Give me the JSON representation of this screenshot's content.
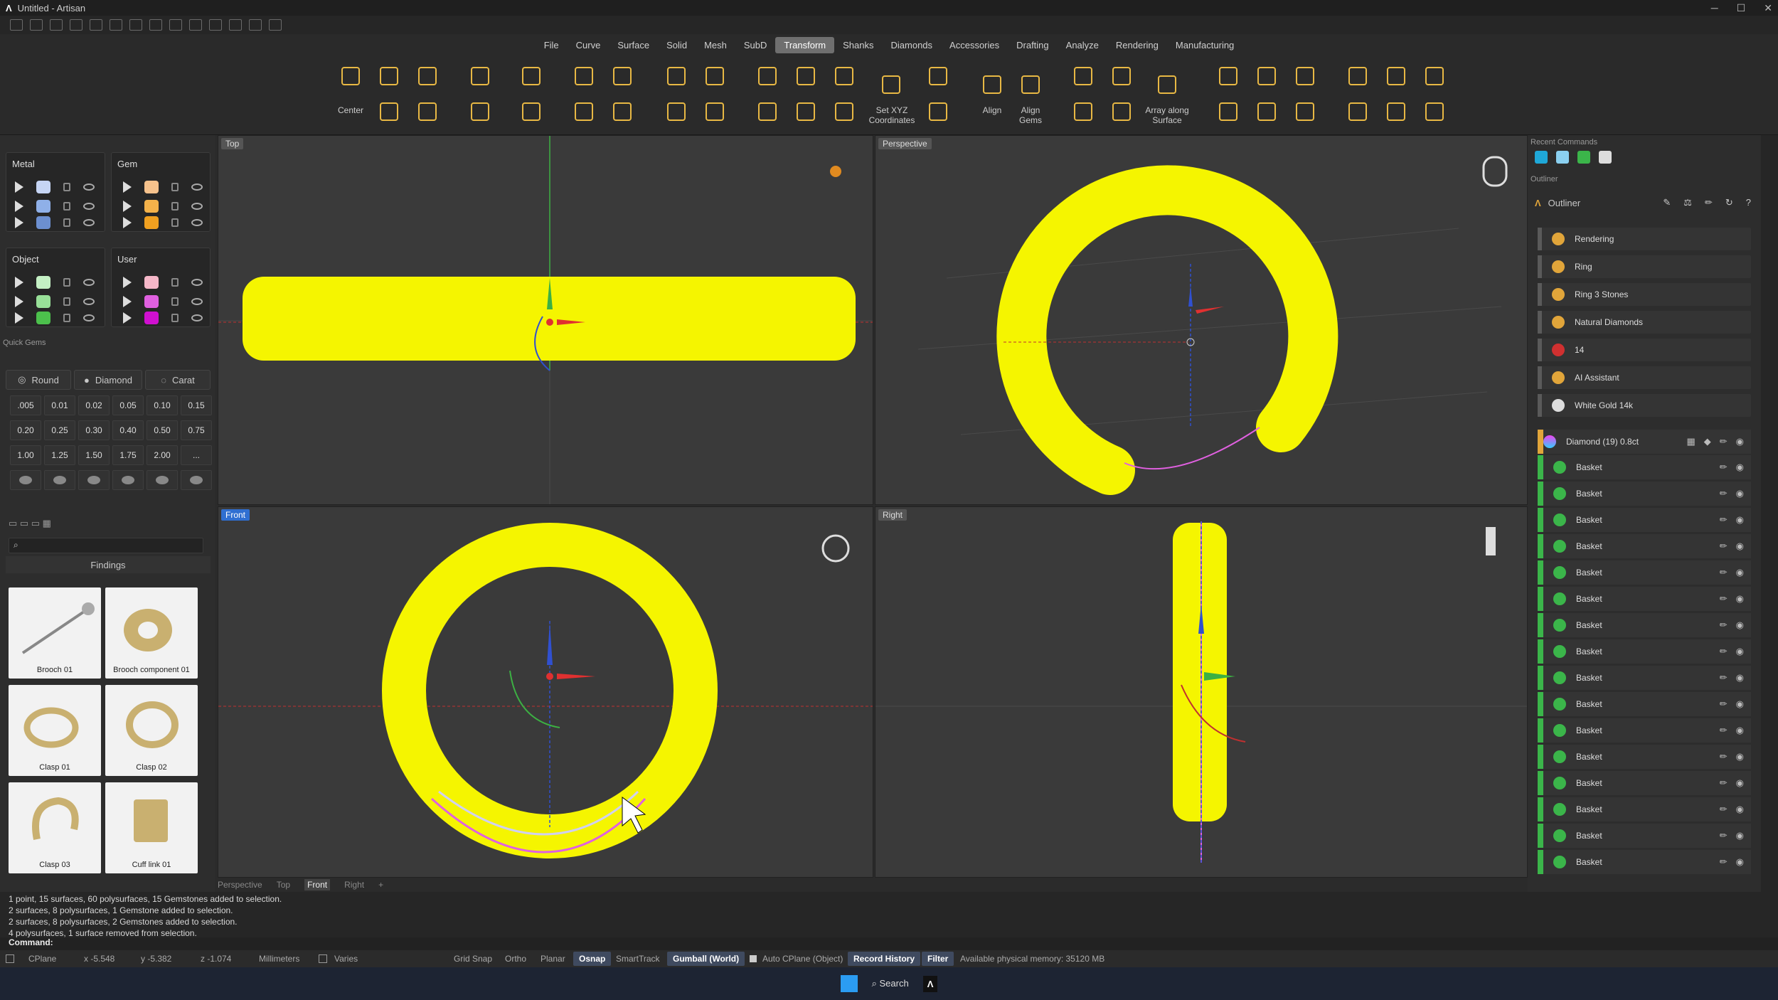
{
  "window": {
    "title": "Untitled - Artisan"
  },
  "menu": [
    "File",
    "Curve",
    "Surface",
    "Solid",
    "Mesh",
    "SubD",
    "Transform",
    "Shanks",
    "Diamonds",
    "Accessories",
    "Drafting",
    "Analyze",
    "Rendering",
    "Manufacturing"
  ],
  "menu_active": "Transform",
  "ribbon_labels": {
    "center": "Center",
    "set_xyz": "Set XYZ\nCoordinates",
    "align": "Align",
    "align_gems": "Align\nGems",
    "array_surface": "Array along\nSurface"
  },
  "layers": {
    "metal": {
      "title": "Metal",
      "colors": [
        "#c6d5f4",
        "#8fb0e8",
        "#6c8fd0"
      ]
    },
    "gem": {
      "title": "Gem",
      "colors": [
        "#f6c28c",
        "#f4b24a",
        "#f0a020"
      ]
    },
    "object": {
      "title": "Object",
      "colors": [
        "#c4f0c4",
        "#98e098",
        "#4cc04c"
      ]
    },
    "user": {
      "title": "User",
      "colors": [
        "#f5b7c8",
        "#e060e0",
        "#d010d0"
      ]
    }
  },
  "quick_gems": {
    "title": "Quick Gems",
    "tabs": [
      "Round",
      "Diamond",
      "Carat"
    ],
    "sizes": [
      ".005",
      "0.01",
      "0.02",
      "0.05",
      "0.10",
      "0.15",
      "0.20",
      "0.25",
      "0.30",
      "0.40",
      "0.50",
      "0.75",
      "1.00",
      "1.25",
      "1.50",
      "1.75",
      "2.00",
      "..."
    ]
  },
  "findings": {
    "header": "Findings",
    "items": [
      "Brooch 01",
      "Brooch component 01",
      "Clasp 01",
      "Clasp 02",
      "Clasp 03",
      "Cuff link 01"
    ]
  },
  "viewports": {
    "top": "Top",
    "perspective": "Perspective",
    "front": "Front",
    "right": "Right"
  },
  "viewport_tabs": [
    "Perspective",
    "Top",
    "Front",
    "Right"
  ],
  "viewport_tabs_active": "Front",
  "recent": {
    "title": "Recent Commands"
  },
  "outliner": {
    "section": "Outliner",
    "title": "Outliner",
    "rows": [
      "Rendering",
      "Ring",
      "Ring 3 Stones",
      "Natural Diamonds",
      "14",
      "AI Assistant",
      "White Gold 14k"
    ],
    "diamond_group": "Diamond (19) 0.8ct",
    "baskets": [
      "Basket",
      "Basket",
      "Basket",
      "Basket",
      "Basket",
      "Basket",
      "Basket",
      "Basket",
      "Basket",
      "Basket",
      "Basket",
      "Basket",
      "Basket",
      "Basket",
      "Basket",
      "Basket"
    ]
  },
  "history": [
    "1 point, 15 surfaces, 60 polysurfaces, 15 Gemstones added to selection.",
    "2 surfaces, 8 polysurfaces, 1 Gemstone added to selection.",
    "2 surfaces, 8 polysurfaces, 2 Gemstones added to selection.",
    "4 polysurfaces, 1 surface removed from selection."
  ],
  "command_label": "Command:",
  "status": {
    "cplane": "CPlane",
    "x": "x -5.548",
    "y": "y -5.382",
    "z": "z -1.074",
    "units": "Millimeters",
    "layer": "Varies",
    "grid_snap": "Grid Snap",
    "ortho": "Ortho",
    "planar": "Planar",
    "osnap": "Osnap",
    "smarttrack": "SmartTrack",
    "gumball": "Gumball (World)",
    "auto_cplane": "Auto CPlane (Object)",
    "record_history": "Record History",
    "filter": "Filter",
    "memory": "Available physical memory: 35120 MB"
  },
  "taskbar": {
    "search": "Search"
  },
  "colors": {
    "ring": "#f5f500",
    "accent": "#2f6fd1",
    "basket_green": "#3bb54a"
  }
}
